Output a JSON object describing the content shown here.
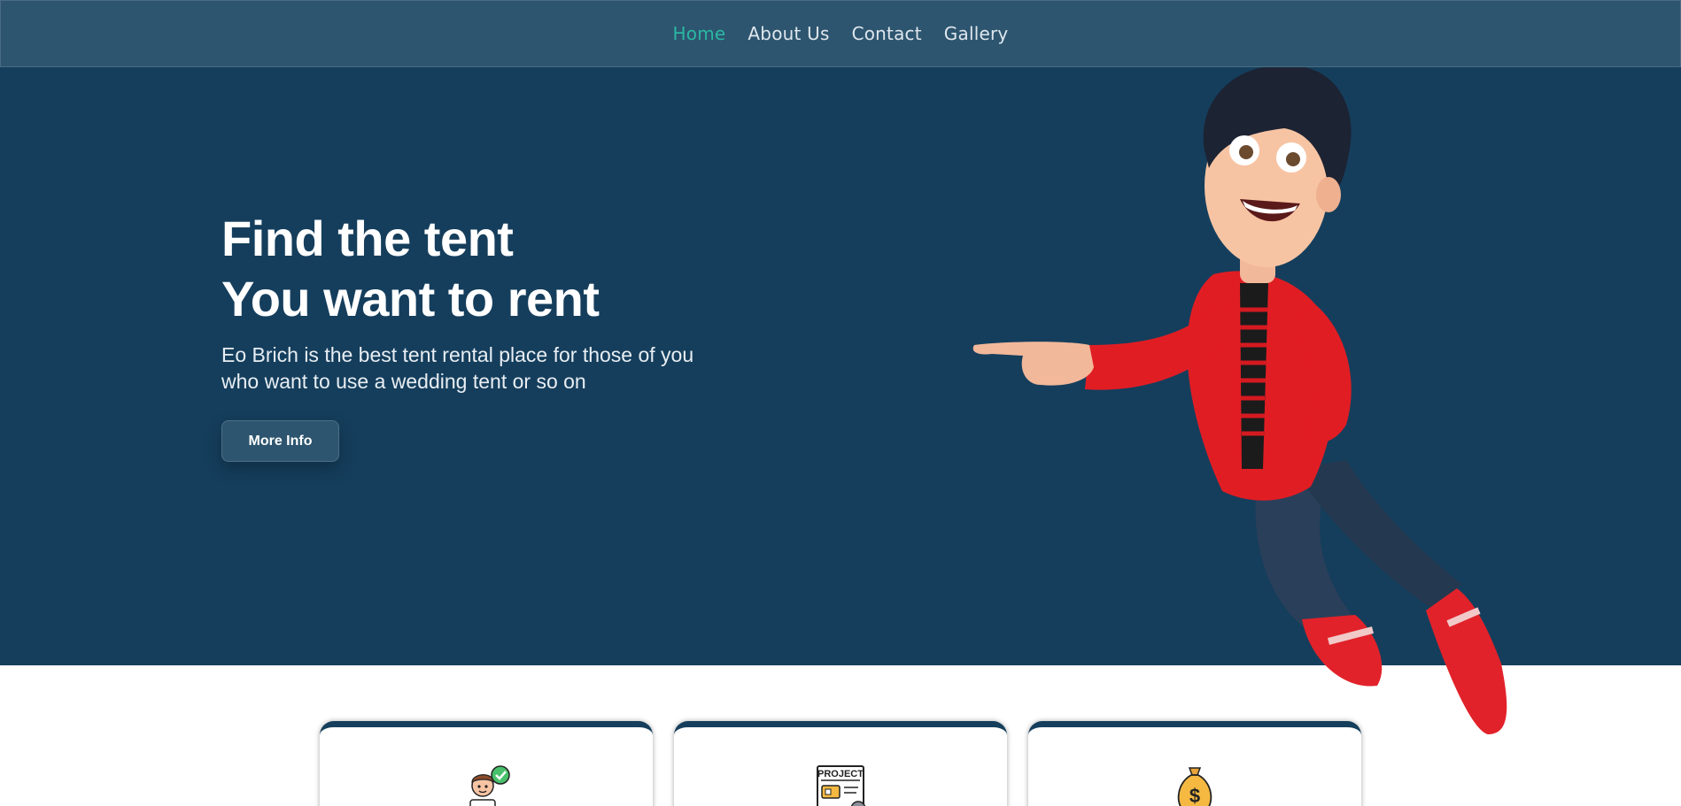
{
  "nav": {
    "items": [
      {
        "label": "Home",
        "active": true
      },
      {
        "label": "About Us",
        "active": false
      },
      {
        "label": "Contact",
        "active": false
      },
      {
        "label": "Gallery",
        "active": false
      }
    ]
  },
  "hero": {
    "title_line1": "Find the tent",
    "title_line2": "You want to rent",
    "subtitle": "Eo Brich is the best tent rental place for those of you who want to use a wedding tent or so on",
    "button_label": "More Info",
    "image": "3d-cartoon-boy-pointing"
  },
  "cards": [
    {
      "icon": "person-check-icon"
    },
    {
      "icon": "project-document-icon",
      "icon_text": "PROJECT"
    },
    {
      "icon": "money-bag-icon",
      "icon_text": "$"
    }
  ],
  "colors": {
    "hero_background": "#153e5c",
    "navbar_background": "#2d556f",
    "nav_active": "#2bb7a3",
    "card_top_border": "#153e5c"
  }
}
